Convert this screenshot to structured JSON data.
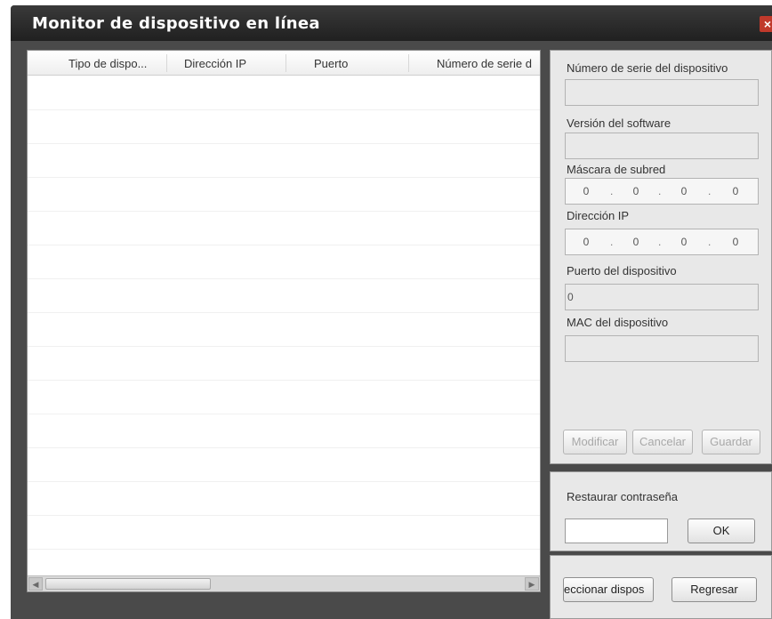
{
  "window": {
    "title": "Monitor de dispositivo en línea"
  },
  "list": {
    "columns": [
      "Tipo de dispo...",
      "Dirección IP",
      "Puerto",
      "Número de serie d"
    ]
  },
  "details": {
    "serial_label": "Número de serie del dispositivo",
    "serial_value": "",
    "software_label": "Versión del software",
    "software_value": "",
    "subnet_label": "Máscara de subred",
    "subnet": [
      "0",
      "0",
      "0",
      "0"
    ],
    "ip_label": "Dirección IP",
    "ip": [
      "0",
      "0",
      "0",
      "0"
    ],
    "port_label": "Puerto del dispositivo",
    "port_value": "0",
    "mac_label": "MAC del dispositivo",
    "mac_value": "",
    "modify_button": "Modificar",
    "cancel_button": "Cancelar",
    "save_button": "Guardar"
  },
  "reset": {
    "label": "Restaurar contraseña",
    "ok_button": "OK",
    "password_value": ""
  },
  "actions": {
    "select_button": "eccionar dispos",
    "back_button": "Regresar"
  }
}
